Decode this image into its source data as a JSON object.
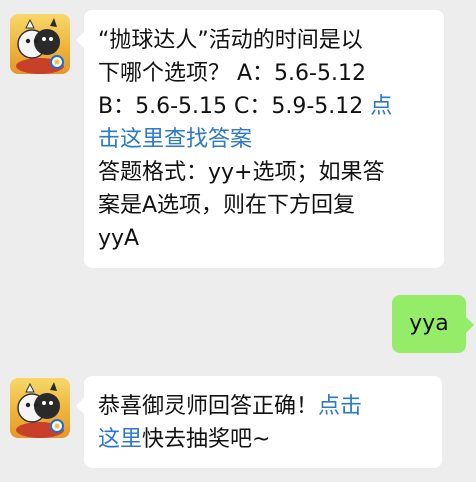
{
  "colors": {
    "background": "#ededed",
    "bubble_received": "#ffffff",
    "bubble_sent": "#95ec69",
    "link": "#2b79c9"
  },
  "messages": [
    {
      "sender": "bot",
      "avatar_icon": "game-mascot-avatar-icon",
      "lines": [
        "“抛球达人”活动的时间是以",
        "下哪个选项？ A：5.6-5.12",
        "B：5.6-5.15 C：5.9-5.12 "
      ],
      "link_inline": "点",
      "link_line": "击这里查找答案",
      "lines_after": [
        "答题格式：yy+选项；如果答",
        "案是A选项，则在下方回复",
        "yyA"
      ]
    },
    {
      "sender": "user",
      "text": "yya"
    },
    {
      "sender": "bot",
      "avatar_icon": "game-mascot-avatar-icon",
      "text_before": "恭喜御灵师回答正确！",
      "link_part1": "点击",
      "link_part2": "这里",
      "text_after": "快去抽奖吧~"
    }
  ]
}
